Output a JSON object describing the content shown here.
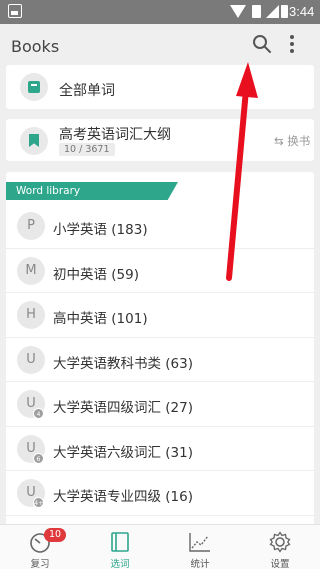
{
  "status_bar": {
    "time": "3:44"
  },
  "app_bar": {
    "title": "Books",
    "search_icon": "search-icon",
    "menu_icon": "more-vert-icon"
  },
  "all_words": {
    "label": "全部单词",
    "icon": "book-icon"
  },
  "current_book": {
    "title": "高考英语词汇大纲",
    "progress": "10 / 3671",
    "swap_label": "⇆ 换书",
    "icon": "bookmark-icon"
  },
  "library": {
    "header": "Word library",
    "items": [
      {
        "letter": "P",
        "name": "小学英语 (183)",
        "sub": ""
      },
      {
        "letter": "M",
        "name": "初中英语 (59)",
        "sub": ""
      },
      {
        "letter": "H",
        "name": "高中英语 (101)",
        "sub": ""
      },
      {
        "letter": "U",
        "name": "大学英语教科书类 (63)",
        "sub": ""
      },
      {
        "letter": "U",
        "name": "大学英语四级词汇 (27)",
        "sub": "4"
      },
      {
        "letter": "U",
        "name": "大学英语六级词汇 (31)",
        "sub": "6"
      },
      {
        "letter": "U",
        "name": "大学英语专业四级 (16)",
        "sub": "4+"
      }
    ]
  },
  "bottom_nav": {
    "items": [
      {
        "label": "复习",
        "icon": "clock-icon",
        "badge": "10",
        "active": false
      },
      {
        "label": "选词",
        "icon": "book-select-icon",
        "badge": "",
        "active": true
      },
      {
        "label": "统计",
        "icon": "chart-icon",
        "badge": "",
        "active": false
      },
      {
        "label": "设置",
        "icon": "gear-icon",
        "badge": "",
        "active": false
      }
    ]
  },
  "colors": {
    "accent": "#2ea68c",
    "badge": "#e0393b",
    "annotation": "#e8101f"
  }
}
